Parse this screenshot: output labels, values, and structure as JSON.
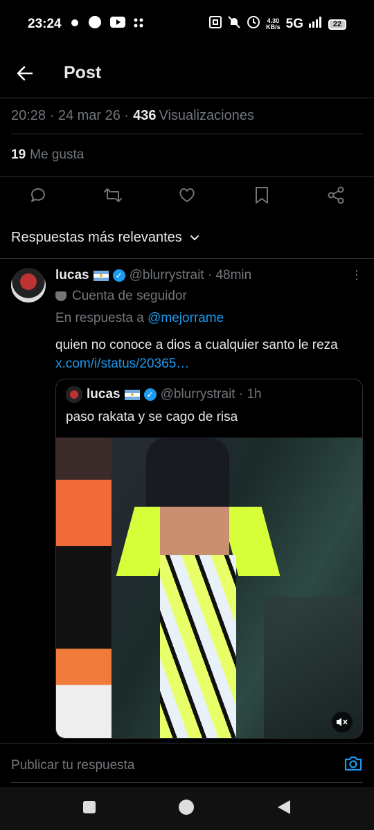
{
  "status_bar": {
    "time": "23:24",
    "network_speed_value": "4.30",
    "network_speed_unit": "KB/s",
    "network": "5G",
    "battery": "22"
  },
  "header": {
    "title": "Post"
  },
  "post_meta": {
    "timestamp": "20:28 · 24 mar 26 ·",
    "views_count": "436",
    "views_label": "Visualizaciones"
  },
  "likes": {
    "count": "19",
    "label": "Me gusta"
  },
  "sort": {
    "label": "Respuestas más relevantes"
  },
  "reply": {
    "name": "lucas",
    "handle_time": "@blurrystrait · 48min",
    "badge_label": "Cuenta de seguidor",
    "in_reply_prefix": "En respuesta a",
    "in_reply_mention": "@mejorrame",
    "text": "quien no conoce a dios a cualquier santo le reza",
    "link": "x.com/i/status/20365…",
    "quote": {
      "name": "lucas",
      "handle_time": "@blurrystrait · 1h",
      "text": "paso rakata y se cago de risa"
    }
  },
  "compose": {
    "placeholder": "Publicar tu respuesta"
  },
  "colors": {
    "accent": "#1d9bf0",
    "muted": "#71767b",
    "background": "#000000"
  }
}
